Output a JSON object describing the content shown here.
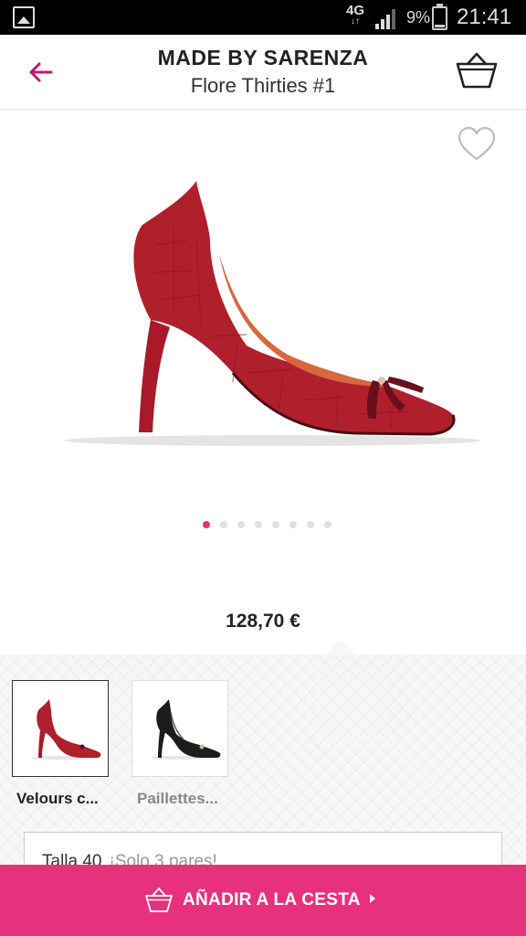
{
  "status_bar": {
    "network": "4G",
    "network_arrows": "↓↑",
    "battery": "9%",
    "time": "21:41"
  },
  "header": {
    "brand": "MADE BY SARENZA",
    "product_name": "Flore Thirties #1"
  },
  "gallery": {
    "image_count": 8,
    "active_index": 0
  },
  "price": "128,70 €",
  "variants": [
    {
      "label": "Velours c...",
      "color": "#b0202c",
      "selected": true
    },
    {
      "label": "Paillettes...",
      "color": "#1c1c1c",
      "selected": false
    }
  ],
  "size_selector": {
    "size": "Talla 40",
    "note": "¡Solo 3 pares!"
  },
  "add_to_cart": {
    "label": "AÑADIR A LA CESTA"
  },
  "colors": {
    "accent": "#e8317d",
    "shoe_red": "#b0202c"
  }
}
